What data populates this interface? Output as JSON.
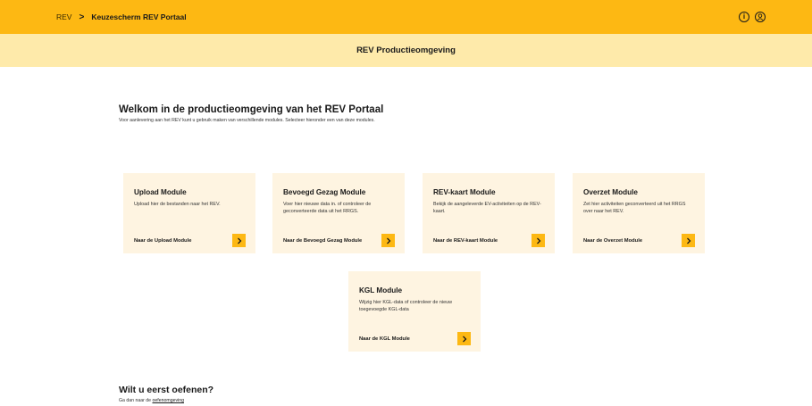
{
  "header": {
    "breadcrumb_home": "REV",
    "breadcrumb_separator": ">",
    "breadcrumb_current": "Keuzescherm REV Portaal",
    "icons": [
      "info-icon",
      "user-icon"
    ]
  },
  "subheader": {
    "title": "REV Productieomgeving"
  },
  "welcome": {
    "title": "Welkom in de productieomgeving van het REV Portaal",
    "description": "Voor aanlevering aan het REV kunt u gebruik maken van verschillende modules. Selecteer hieronder een van deze modules."
  },
  "modules": [
    {
      "title": "Upload Module",
      "description": "Upload hier de bestanden naar het REV.",
      "link": "Naar de Upload Module"
    },
    {
      "title": "Bevoegd Gezag Module",
      "description": "Voer hier nieuwe data in. of controleer de geconverteerde data uit het RRGS.",
      "link": "Naar de Bevoegd Gezag Module"
    },
    {
      "title": "REV-kaart Module",
      "description": "Bekijk de aangeleverde EV-activiteiten op de REV-kaart.",
      "link": "Naar de REV-kaart Module"
    },
    {
      "title": "Overzet Module",
      "description": "Zet hier activiteiten geconverteerd uit het RRGS over naar het REV.",
      "link": "Naar de Overzet Module"
    },
    {
      "title": "KGL Module",
      "description": "Wijzig hier KGL-data of controleer de nieuw toegevoegde KGL-data",
      "link": "Naar de KGL Module"
    }
  ],
  "practice": {
    "title": "Wilt u eerst oefenen?",
    "text_prefix": "Ga dan naar de ",
    "link": "oefenomgeving"
  },
  "colors": {
    "accent": "#fdb813",
    "subbar": "#feeaaa",
    "card": "#fef4e1"
  }
}
